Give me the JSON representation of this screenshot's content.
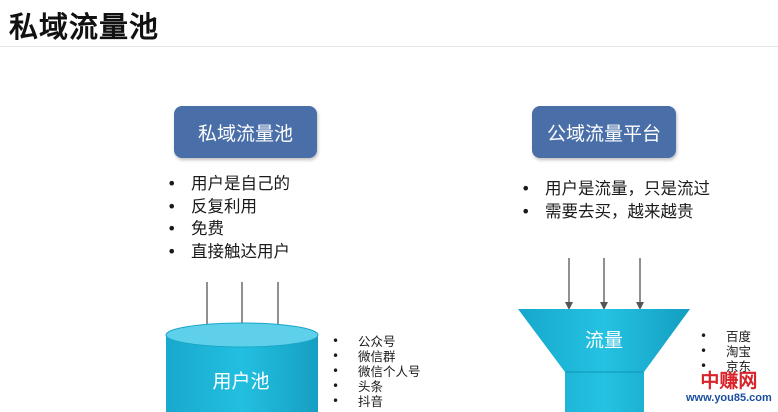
{
  "title": "私域流量池",
  "colors": {
    "box": "#4a6fa8",
    "cyan": "#1bb4d6",
    "cyan_dark": "#0f93b3",
    "cyan_light": "#5fd0ea",
    "arrow": "#555555"
  },
  "private": {
    "box_label": "私域流量池",
    "bullets": [
      "用户是自己的",
      "反复利用",
      "免费",
      "直接触达用户"
    ],
    "pool_label": "用户池",
    "channels": [
      "公众号",
      "微信群",
      "微信个人号",
      "头条",
      "抖音"
    ]
  },
  "public": {
    "box_label": "公域流量平台",
    "bullets": [
      "用户是流量，只是流过",
      "需要去买，越来越贵"
    ],
    "funnel_label": "流量",
    "channels": [
      "百度",
      "淘宝",
      "京东"
    ]
  },
  "watermark": {
    "name": "中赚网",
    "url": "www.you85.com"
  }
}
